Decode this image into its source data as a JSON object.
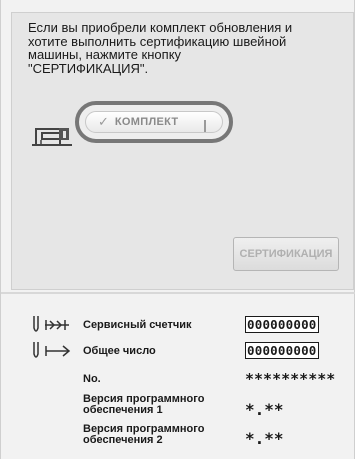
{
  "message": "Если вы приобрели комплект обновления и\nхотите выполнить сертификацию швейной\nмашины, нажмите кнопку\n\"СЕРТИФИКАЦИЯ\".",
  "kit_button": {
    "check": "✓",
    "label": "КОМПЛЕКТ"
  },
  "certify_button": {
    "label": "СЕРТИФИКАЦИЯ"
  },
  "rows": [
    {
      "label": "Сервисный счетчик",
      "value": "000000000"
    },
    {
      "label": "Общее число",
      "value": "000000000"
    },
    {
      "label": "No.",
      "value": "**********"
    },
    {
      "label": "Версия программного\nобеспечения 1",
      "value": "*.**"
    },
    {
      "label": "Версия программного\nобеспечения 2",
      "value": "*.**"
    }
  ],
  "icons": [
    "sewing-machine-icon",
    "needle-stitch-icon",
    "needle-arrow-icon"
  ]
}
